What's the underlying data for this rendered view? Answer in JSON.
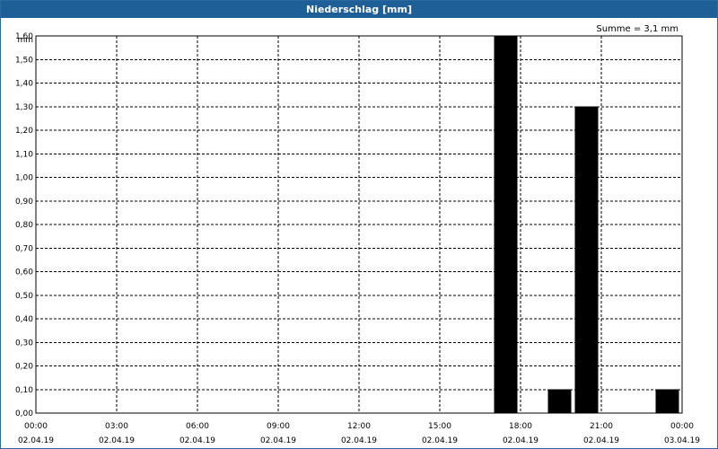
{
  "window": {
    "title": "Niederschlag [mm]"
  },
  "summary": "Summe = 3,1 mm",
  "colors": {
    "titlebar": "#1f5f97",
    "bars": "#000000",
    "grid": "#000000"
  },
  "chart_data": {
    "type": "bar",
    "title": "Niederschlag [mm]",
    "ylabel": "mm",
    "ylim": [
      0,
      1.6
    ],
    "yticks": [
      "0,00",
      "0,10",
      "0,20",
      "0,30",
      "0,40",
      "0,50",
      "0,60",
      "0,70",
      "0,80",
      "0,90",
      "1,00",
      "1,10",
      "1,20",
      "1,30",
      "1,40",
      "1,50",
      "1,60"
    ],
    "xticks": [
      {
        "time": "00:00",
        "date": "02.04.19"
      },
      {
        "time": "03:00",
        "date": "02.04.19"
      },
      {
        "time": "06:00",
        "date": "02.04.19"
      },
      {
        "time": "09:00",
        "date": "02.04.19"
      },
      {
        "time": "12:00",
        "date": "02.04.19"
      },
      {
        "time": "15:00",
        "date": "02.04.19"
      },
      {
        "time": "18:00",
        "date": "02.04.19"
      },
      {
        "time": "21:00",
        "date": "02.04.19"
      },
      {
        "time": "00:00",
        "date": "03.04.19"
      }
    ],
    "grid": true,
    "bars": [
      {
        "start": "02.04.19 17:00",
        "end": "02.04.19 18:00",
        "value": 1.6
      },
      {
        "start": "02.04.19 19:00",
        "end": "02.04.19 20:00",
        "value": 0.1
      },
      {
        "start": "02.04.19 20:00",
        "end": "02.04.19 21:00",
        "value": 1.3
      },
      {
        "start": "02.04.19 23:00",
        "end": "03.04.19 00:00",
        "value": 0.1
      }
    ]
  }
}
